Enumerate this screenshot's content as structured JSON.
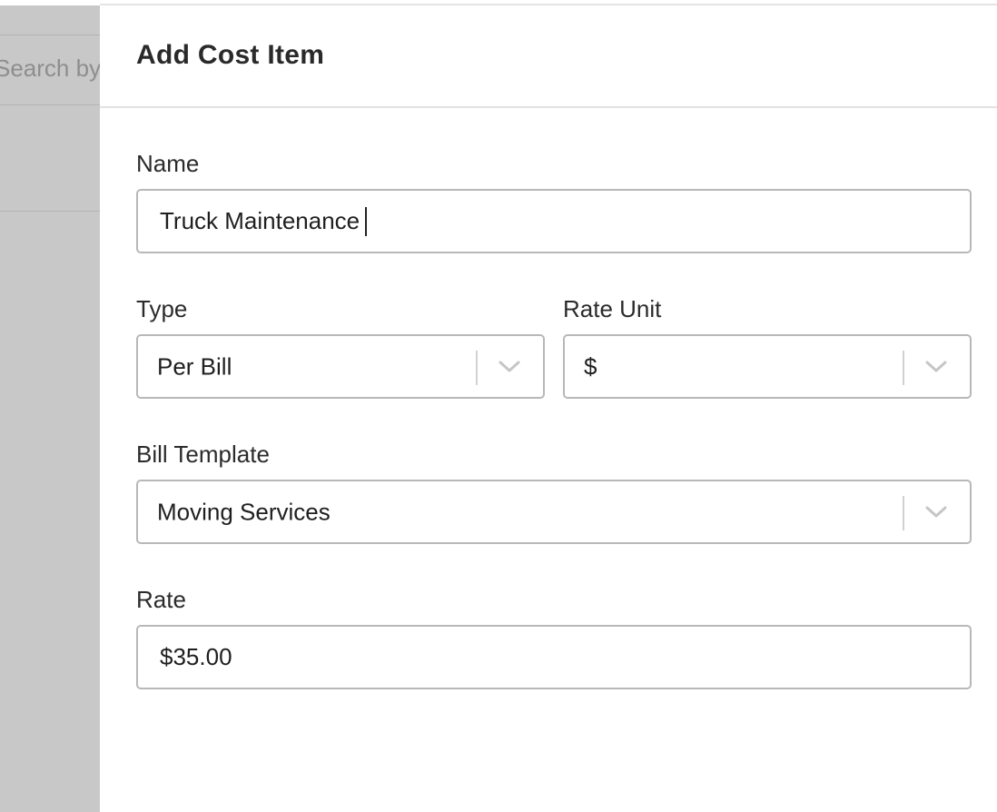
{
  "backdrop": {
    "search_placeholder": "Search by"
  },
  "dialog": {
    "title": "Add Cost Item"
  },
  "form": {
    "name": {
      "label": "Name",
      "value": "Truck Maintenance"
    },
    "type": {
      "label": "Type",
      "selected": "Per Bill"
    },
    "rate_unit": {
      "label": "Rate Unit",
      "selected": "$"
    },
    "bill_template": {
      "label": "Bill Template",
      "selected": "Moving Services"
    },
    "rate": {
      "label": "Rate",
      "value": "$35.00"
    }
  },
  "icons": {
    "dropdown": "chevron-down-icon"
  },
  "colors": {
    "backdrop": "#c8c8c8",
    "border": "#b8b8b8",
    "text": "#222222"
  }
}
